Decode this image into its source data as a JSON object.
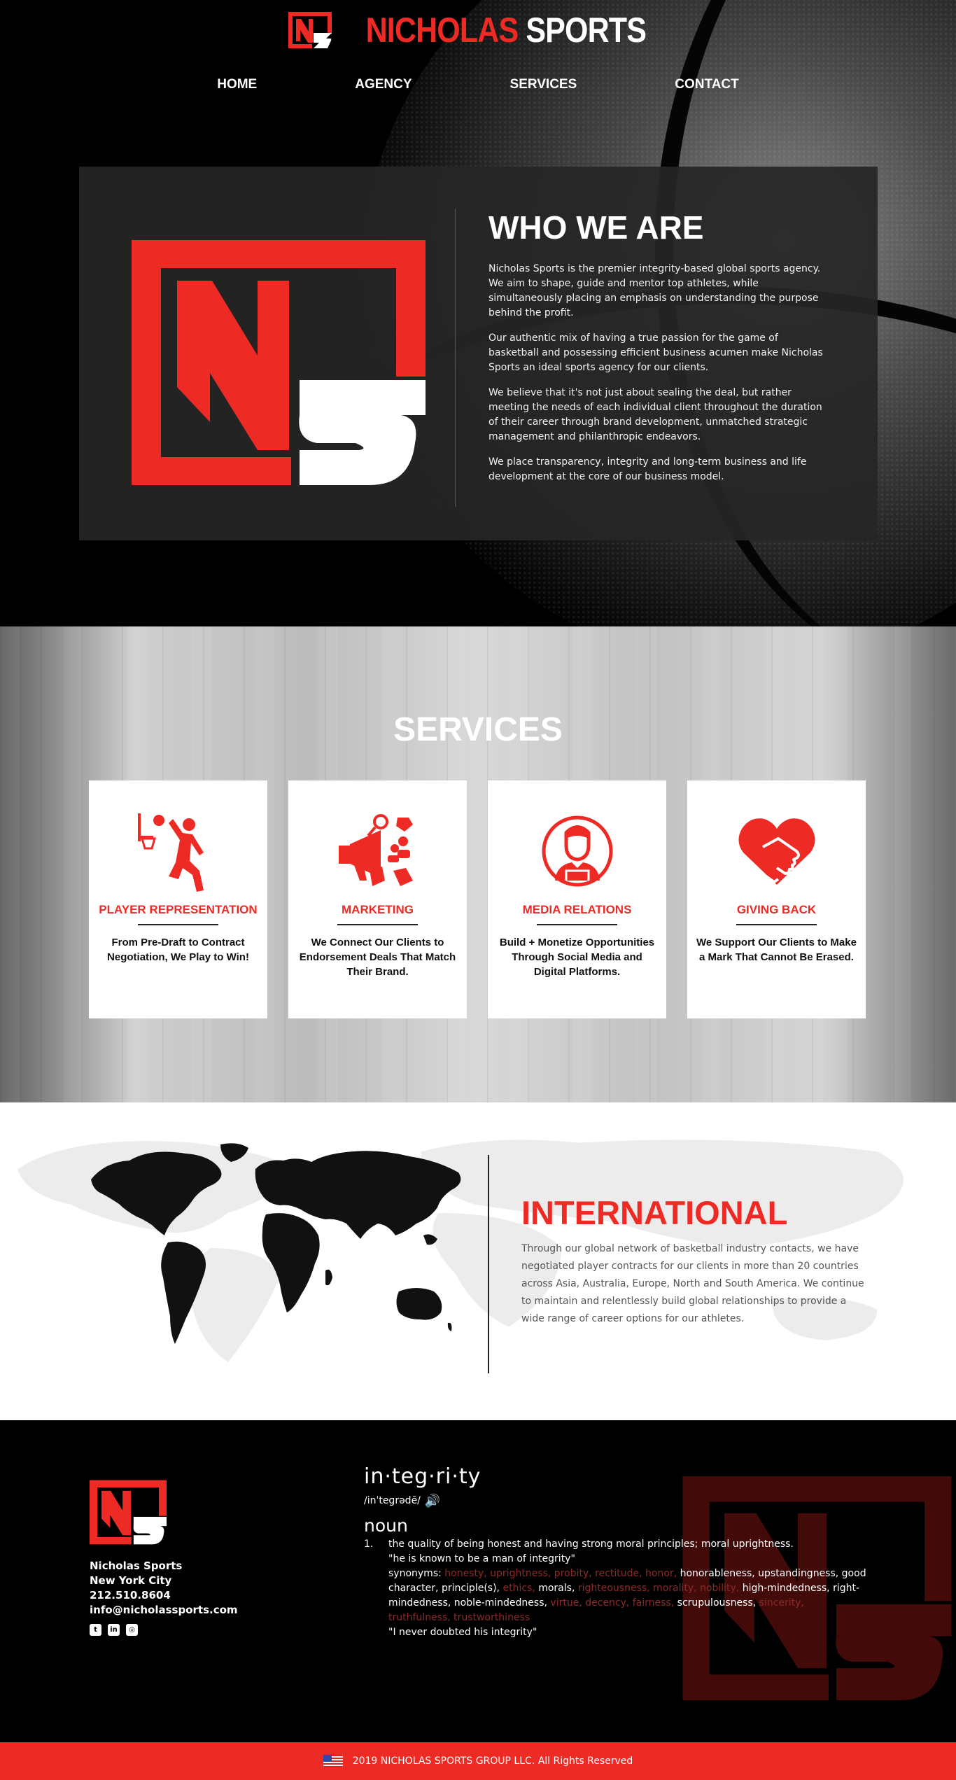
{
  "brand": {
    "name_red": "NICHOLAS",
    "name_white": "SPORTS"
  },
  "nav": {
    "items": [
      "HOME",
      "AGENCY",
      "SERVICES",
      "CONTACT"
    ]
  },
  "about": {
    "title": "WHO WE ARE",
    "paragraphs": [
      "Nicholas Sports is the premier integrity-based global sports agency. We aim to shape, guide and mentor top athletes, while simultaneously placing an emphasis on understanding the purpose behind the profit.",
      "Our authentic mix of having a true passion for the game of basketball and possessing efficient business acumen make Nicholas Sports an ideal sports agency for our clients.",
      "We believe that it's not just about sealing the deal, but rather meeting the needs of each individual client throughout the duration of their career through brand development, unmatched strategic management and philanthropic endeavors.",
      "We place transparency, integrity and long-term business and life development at the core of our business model."
    ]
  },
  "services": {
    "title": "SERVICES",
    "cards": [
      {
        "title": "PLAYER REPRESENTATION",
        "desc": "From Pre-Draft to Contract Negotiation, We Play to Win!",
        "icon": "basketball-player-icon"
      },
      {
        "title": "MARKETING",
        "desc": "We Connect Our Clients to Endorsement Deals That Match Their Brand.",
        "icon": "megaphone-icon"
      },
      {
        "title": "MEDIA RELATIONS",
        "desc": "Build + Monetize Opportunities Through Social Media and Digital Platforms.",
        "icon": "person-avatar-icon"
      },
      {
        "title": "GIVING BACK",
        "desc": "We Support Our Clients to Make a Mark That Cannot Be Erased.",
        "icon": "heart-handshake-icon"
      }
    ]
  },
  "international": {
    "title": "INTERNATIONAL",
    "body": "Through our global network of basketball industry contacts, we have negotiated player contracts for our clients in more than 20 countries across Asia, Australia, Europe, North and South America. We continue to maintain and relentlessly build global relationships to provide a wide range of career options for our athletes."
  },
  "footer": {
    "contact": {
      "name": "Nicholas Sports",
      "city": "New York City",
      "phone": "212.510.8604",
      "email": "info@nicholassports.com"
    },
    "social": [
      "twitter-icon",
      "linkedin-icon",
      "instagram-icon"
    ],
    "dictionary": {
      "word": "in·teg·ri·ty",
      "pronunciation": "/inˈteɡrədē/",
      "pos": "noun",
      "number": "1.",
      "definition": "the quality of being honest and having strong moral principles; moral uprightness.",
      "example1": "\"he is known to be a man of integrity\"",
      "synonyms_label": "synonyms:",
      "syn1": "honesty, uprightness, probity, rectitude, honor,",
      "syn2": " honorableness, upstandingness, good character, principle(s), ",
      "syn3": "ethics,",
      "syn4": " morals, ",
      "syn5": "righteousness, morality, nobility,",
      "syn6": " high-mindedness, right-mindedness, noble-mindedness, ",
      "syn7": "virtue, decency, fairness,",
      "syn8": " scrupulousness, ",
      "syn9": "sincerity, truthfulness, trustworthiness",
      "example2": "\"I never doubted his integrity\""
    }
  },
  "copyright": "2019 NICHOLAS SPORTS GROUP LLC. All Rights Reserved",
  "colors": {
    "accent": "#ee2a24",
    "dark": "#000000",
    "panel": "#262626"
  }
}
